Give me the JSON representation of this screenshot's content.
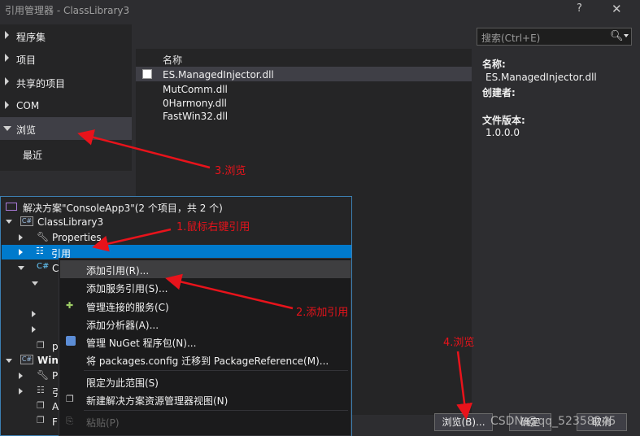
{
  "window": {
    "title": "引用管理器 - ClassLibrary3",
    "help": "?",
    "close": "✕"
  },
  "nav": {
    "items": [
      {
        "label": "程序集"
      },
      {
        "label": "项目"
      },
      {
        "label": "共享的项目"
      },
      {
        "label": "COM"
      },
      {
        "label": "浏览"
      },
      {
        "label": "最近"
      }
    ]
  },
  "list": {
    "column_header": "名称",
    "items": [
      "ES.ManagedInjector.dll",
      "MutComm.dll",
      "0Harmony.dll",
      "FastWin32.dll"
    ]
  },
  "search": {
    "placeholder": "搜索(Ctrl+E)"
  },
  "details": {
    "name_label": "名称:",
    "name_value": "ES.ManagedInjector.dll",
    "creator_label": "创建者:",
    "version_label": "文件版本:",
    "version_value": "1.0.0.0"
  },
  "solution_explorer": {
    "solution": "解决方案\"ConsoleApp3\"(2 个项目，共 2 个)",
    "project1": "ClassLibrary3",
    "properties": "Properties",
    "references": "引用",
    "c_partial": "C",
    "project2_partial": "Win",
    "p_partial": "p",
    "p2_partial": "P",
    "e_partial": "引",
    "a_partial": "A",
    "f_partial": "F"
  },
  "context_menu": {
    "items": [
      "添加引用(R)...",
      "添加服务引用(S)...",
      "管理连接的服务(C)",
      "添加分析器(A)...",
      "管理 NuGet 程序包(N)...",
      "将 packages.config 迁移到 PackageReference(M)...",
      "限定为此范围(S)",
      "新建解决方案资源管理器视图(N)",
      "粘贴(P)"
    ]
  },
  "buttons": {
    "browse": "浏览(B)...",
    "ok": "确定",
    "cancel": "取消"
  },
  "annotations": {
    "a1": "1.鼠标右键引用",
    "a2": "2.添加引用",
    "a3": "3.浏览",
    "a4": "4.浏览",
    "color": "#e8131b"
  },
  "watermark": "CSDN @qq_52358245"
}
